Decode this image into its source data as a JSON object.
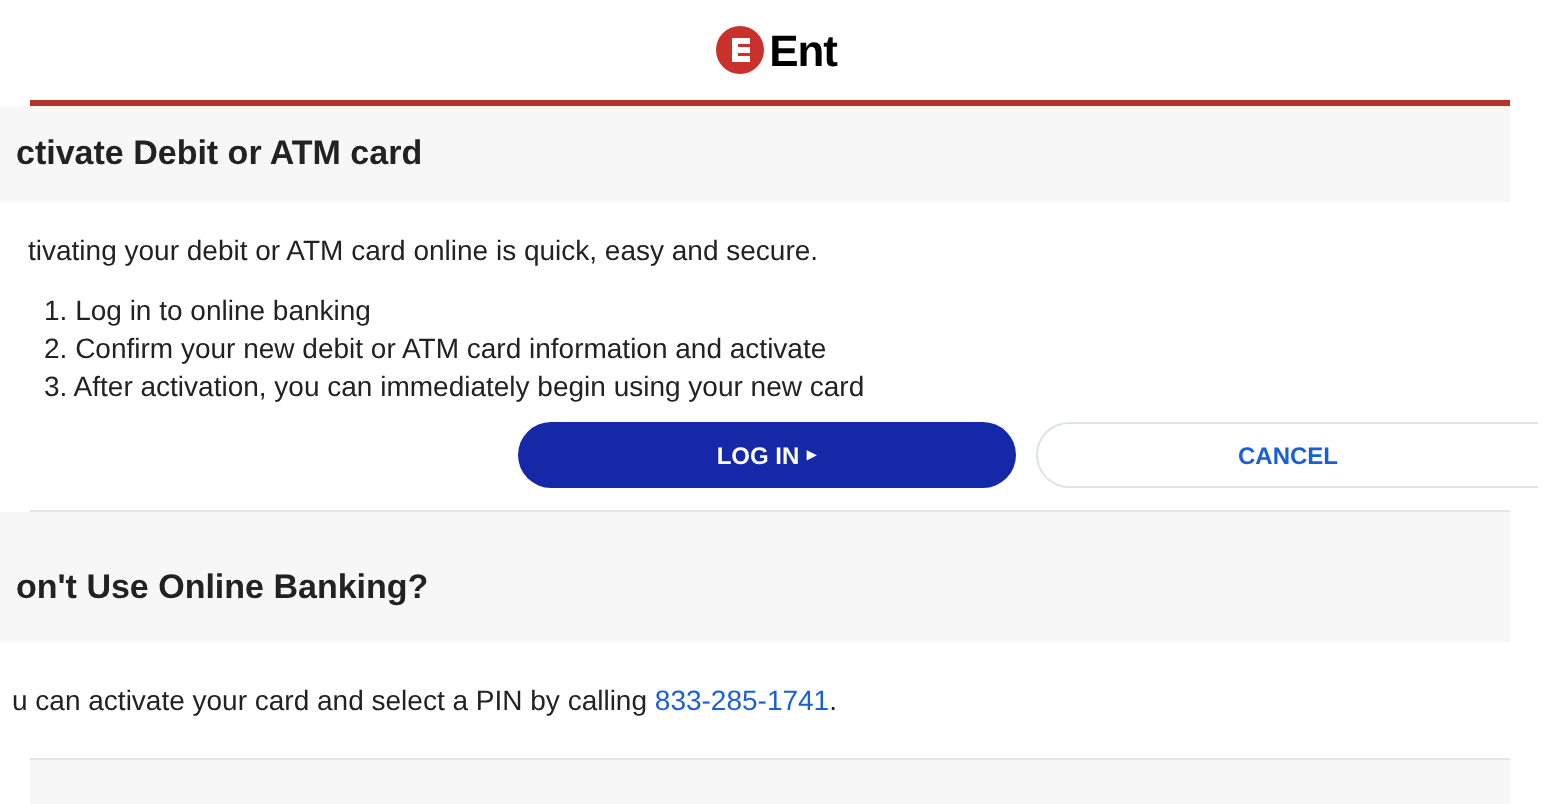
{
  "header": {
    "logo_text": "Ent"
  },
  "activate": {
    "heading": "ctivate Debit or ATM card",
    "intro": "tivating your debit or ATM card online is quick, easy and secure.",
    "steps": [
      "1. Log in to online banking",
      "2. Confirm your new debit or ATM card information and activate",
      "3. After activation, you can immediately begin using your new card"
    ],
    "buttons": [
      {
        "label": "LOG IN",
        "kind": "primary",
        "caret": "▸"
      },
      {
        "label": "CANCEL",
        "kind": "secondary"
      }
    ]
  },
  "phone": {
    "heading": "on't Use Online Banking?",
    "text": "u can activate your card and select a PIN by calling ",
    "link": "833-285-1741",
    "after": "."
  }
}
